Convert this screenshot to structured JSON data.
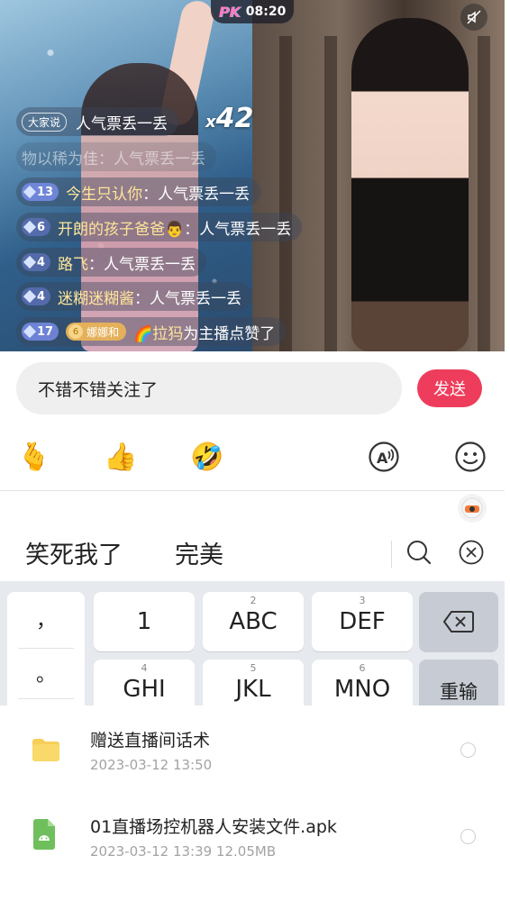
{
  "live": {
    "pk_label": "PK",
    "timer": "08:20",
    "combo_prefix": "x",
    "combo_count": "42",
    "chat": [
      {
        "tag": "大家说",
        "name": "",
        "message": "人气票丢一丢",
        "level": "",
        "fan": ""
      },
      {
        "tag": "",
        "name": "物以稀为佳",
        "message": "：人气票丢一丢",
        "level": "",
        "fan": ""
      },
      {
        "tag": "",
        "name": "今生只认你",
        "message": "：人气票丢一丢",
        "level": "13",
        "fan": ""
      },
      {
        "tag": "",
        "name": "开朗的孩子爸爸👨",
        "message": "：人气票丢一丢",
        "level": "6",
        "fan": ""
      },
      {
        "tag": "",
        "name": "路飞",
        "message": "：人气票丢一丢",
        "level": "4",
        "fan": ""
      },
      {
        "tag": "",
        "name": "迷糊迷糊酱",
        "message": "：人气票丢一丢",
        "level": "4",
        "fan": ""
      },
      {
        "tag": "",
        "name": "🌈拉犸",
        "message": " 为主播点赞了",
        "level": "17",
        "fan": "娜娜和",
        "fan_level": "6"
      }
    ]
  },
  "comment": {
    "value": "不错不错关注了",
    "send_label": "发送"
  },
  "tools": {
    "emoji_1": "🫰",
    "emoji_2": "👍",
    "emoji_3": "🤣",
    "icons": [
      "finger-heart-emoji",
      "thumbs-up-emoji",
      "laughing-emoji",
      "text-style-icon",
      "smiley-icon"
    ]
  },
  "ime": {
    "candidates": [
      "笑死我了",
      "完美"
    ]
  },
  "keyboard": {
    "punct": [
      "，",
      "。",
      "？"
    ],
    "keys": [
      {
        "num": "",
        "label": "1"
      },
      {
        "num": "2",
        "label": "ABC"
      },
      {
        "num": "3",
        "label": "DEF"
      },
      {
        "num": "4",
        "label": "GHI"
      },
      {
        "num": "5",
        "label": "JKL"
      },
      {
        "num": "6",
        "label": "MNO"
      }
    ],
    "retype_label": "重输"
  },
  "files": [
    {
      "name": "赠送直播间话术",
      "meta": "2023-03-12  13:50",
      "type": "folder"
    },
    {
      "name": "01直播场控机器人安装文件.apk",
      "meta": "2023-03-12  13:39  12.05MB",
      "type": "apk"
    }
  ],
  "colors": {
    "send": "#ee3d5c",
    "folder": "#f6cf57",
    "apk": "#6fbf5c"
  }
}
